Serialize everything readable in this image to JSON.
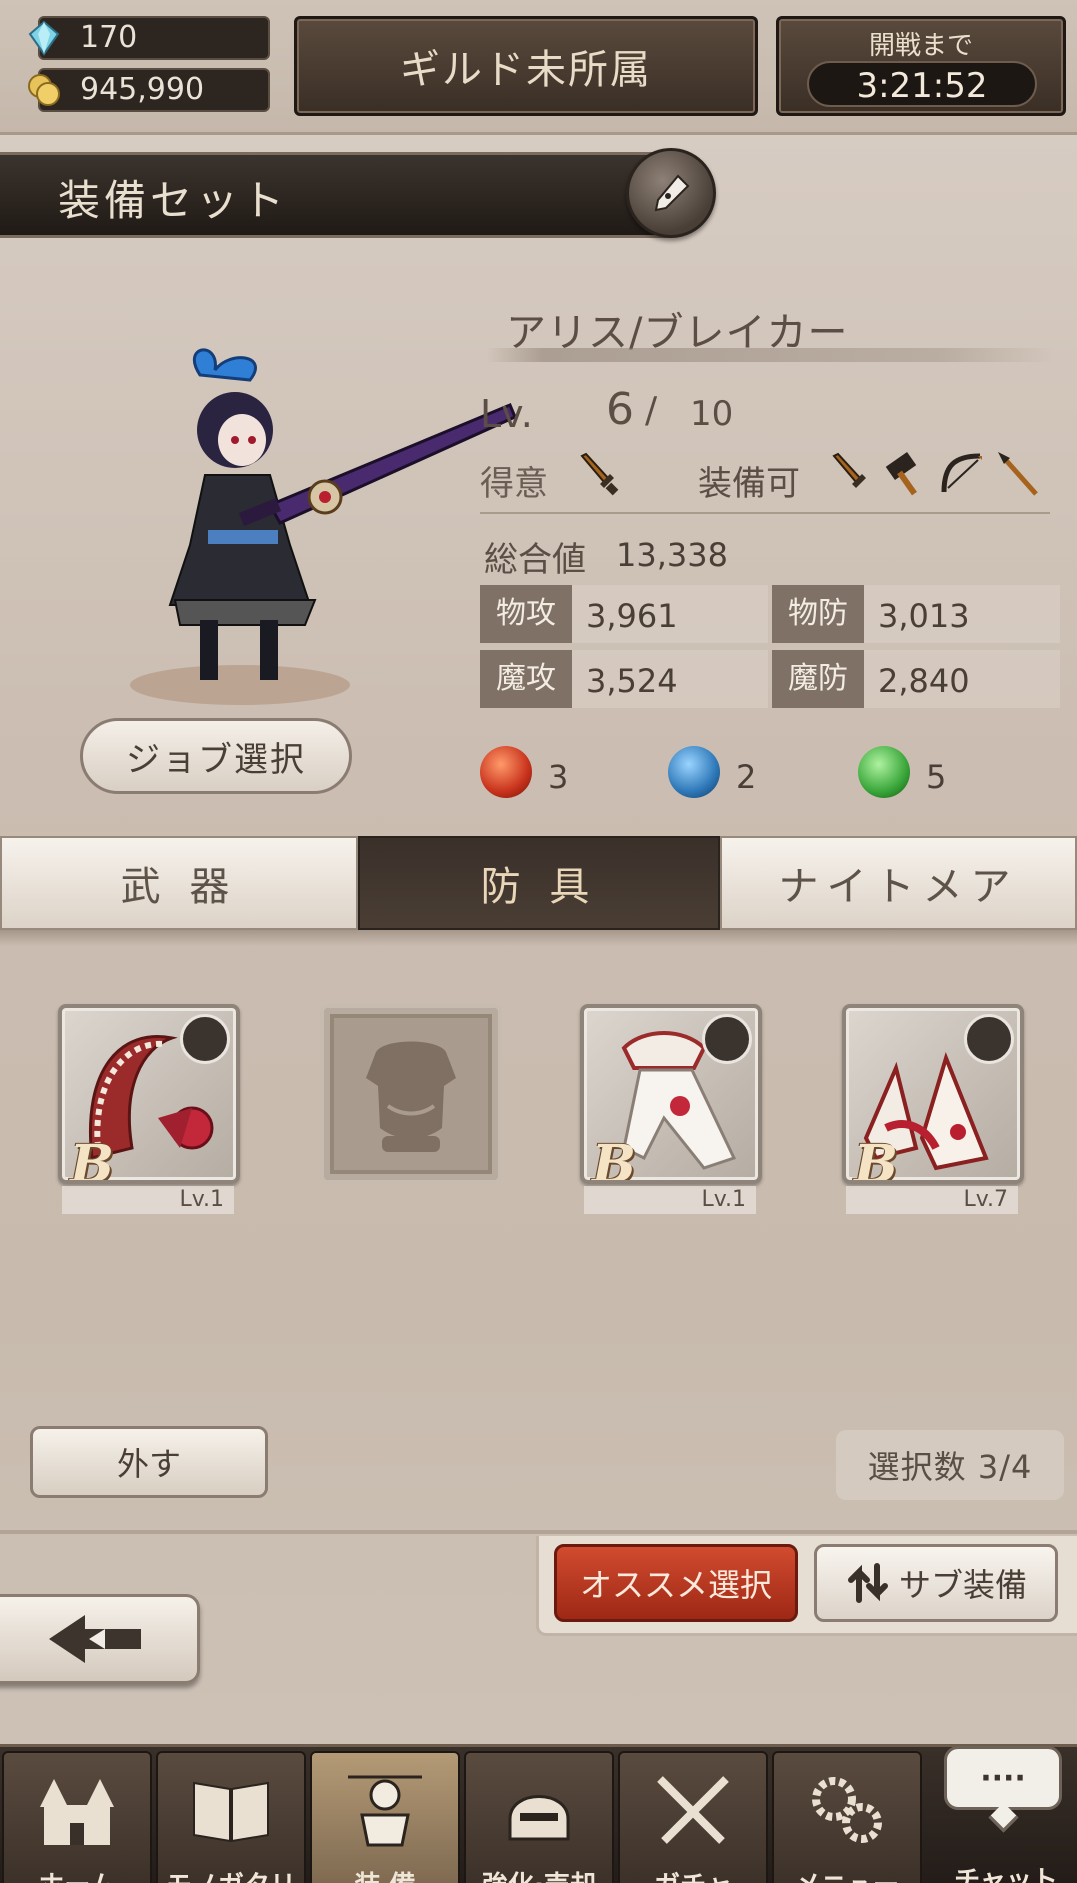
{
  "status": {
    "gems": "170",
    "gold": "945,990",
    "guild": "ギルド未所属",
    "timer_label": "開戦まで",
    "timer_value": "3:21:52"
  },
  "equip_set": {
    "title": "装備セット"
  },
  "character": {
    "name": "アリス/ブレイカー",
    "lv_label": "Lv.",
    "level": "6",
    "level_slash": "/",
    "max_level": "10",
    "specialty_label": "得意",
    "equippable_label": "装備可",
    "specialty_icons": [
      "sword-icon"
    ],
    "equippable_icons": [
      "sword-icon",
      "hammer-icon",
      "bow-icon",
      "spear-icon"
    ],
    "job_button": "ジョブ選択",
    "total_label": "総合値",
    "total_value": "13,338",
    "stats": [
      {
        "key": "物攻",
        "value": "3,961"
      },
      {
        "key": "物防",
        "value": "3,013"
      },
      {
        "key": "魔攻",
        "value": "3,524"
      },
      {
        "key": "魔防",
        "value": "2,840"
      }
    ],
    "elements": [
      {
        "name": "fire-orb-icon",
        "color": "#c8321c",
        "count": "3"
      },
      {
        "name": "water-orb-icon",
        "color": "#2e78b8",
        "count": "2"
      },
      {
        "name": "wind-orb-icon",
        "color": "#3aa63a",
        "count": "5"
      }
    ]
  },
  "tabs": [
    {
      "label": "武 器",
      "active": false
    },
    {
      "label": "防 具",
      "active": true
    },
    {
      "label": "ナイトメア",
      "active": false
    }
  ],
  "slots": [
    {
      "type": "head",
      "rank": "B",
      "level": "Lv.1"
    },
    {
      "type": "body",
      "empty": true
    },
    {
      "type": "hands",
      "rank": "B",
      "level": "Lv.1"
    },
    {
      "type": "feet",
      "rank": "B",
      "level": "Lv.7"
    }
  ],
  "actions": {
    "unequip": "外す",
    "selection_count": "選択数 3/4",
    "recommend": "オススメ選択",
    "sub_equip": "サブ装備"
  },
  "nav": [
    {
      "label": "ホーム",
      "icon": "castle-icon"
    },
    {
      "label": "モノガタリ",
      "icon": "book-icon"
    },
    {
      "label": "装 備",
      "icon": "armor-icon",
      "active": true
    },
    {
      "label": "強化·売却",
      "icon": "helmet-icon"
    },
    {
      "label": "ガチャ",
      "icon": "crossed-swords-icon"
    },
    {
      "label": "メニュー",
      "icon": "gears-icon"
    }
  ],
  "chat": {
    "bubble": "····",
    "label": "チャット"
  }
}
